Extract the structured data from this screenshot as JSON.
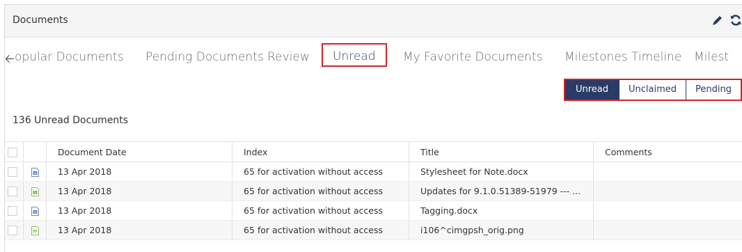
{
  "header": {
    "title": "Documents",
    "icons": [
      "pencil-icon",
      "refresh-icon"
    ]
  },
  "tabs": [
    {
      "label": "opular Documents",
      "active": false
    },
    {
      "label": "Pending Documents Review",
      "active": false
    },
    {
      "label": "Unread",
      "active": true
    },
    {
      "label": "My Favorite Documents",
      "active": false
    },
    {
      "label": "Milestones Timeline",
      "active": false
    },
    {
      "label": "Milest",
      "active": false
    }
  ],
  "filter": {
    "buttons": [
      "Unread",
      "Unclaimed",
      "Pending"
    ],
    "selected": "Unread"
  },
  "summary": {
    "count_text": "136 Unread Documents"
  },
  "table": {
    "columns": [
      "Document Date",
      "Index",
      "Title",
      "Comments"
    ],
    "rows": [
      {
        "icon": "word-doc-icon",
        "date": "13 Apr 2018",
        "index": "65 for activation without access",
        "title": "Stylesheet for Note.docx",
        "comments": ""
      },
      {
        "icon": "excel-doc-icon",
        "date": "13 Apr 2018",
        "index": "65 for activation without access",
        "title": "Updates for 9.1.0.51389-51979 --- ...",
        "comments": ""
      },
      {
        "icon": "word-doc-icon",
        "date": "13 Apr 2018",
        "index": "65 for activation without access",
        "title": "Tagging.docx",
        "comments": ""
      },
      {
        "icon": "image-doc-icon",
        "date": "13 Apr 2018",
        "index": "65 for activation without access",
        "title": "i106^cimgpsh_orig.png",
        "comments": ""
      }
    ]
  },
  "colors": {
    "accent": "#2a3b66",
    "highlight": "#d2232a"
  }
}
